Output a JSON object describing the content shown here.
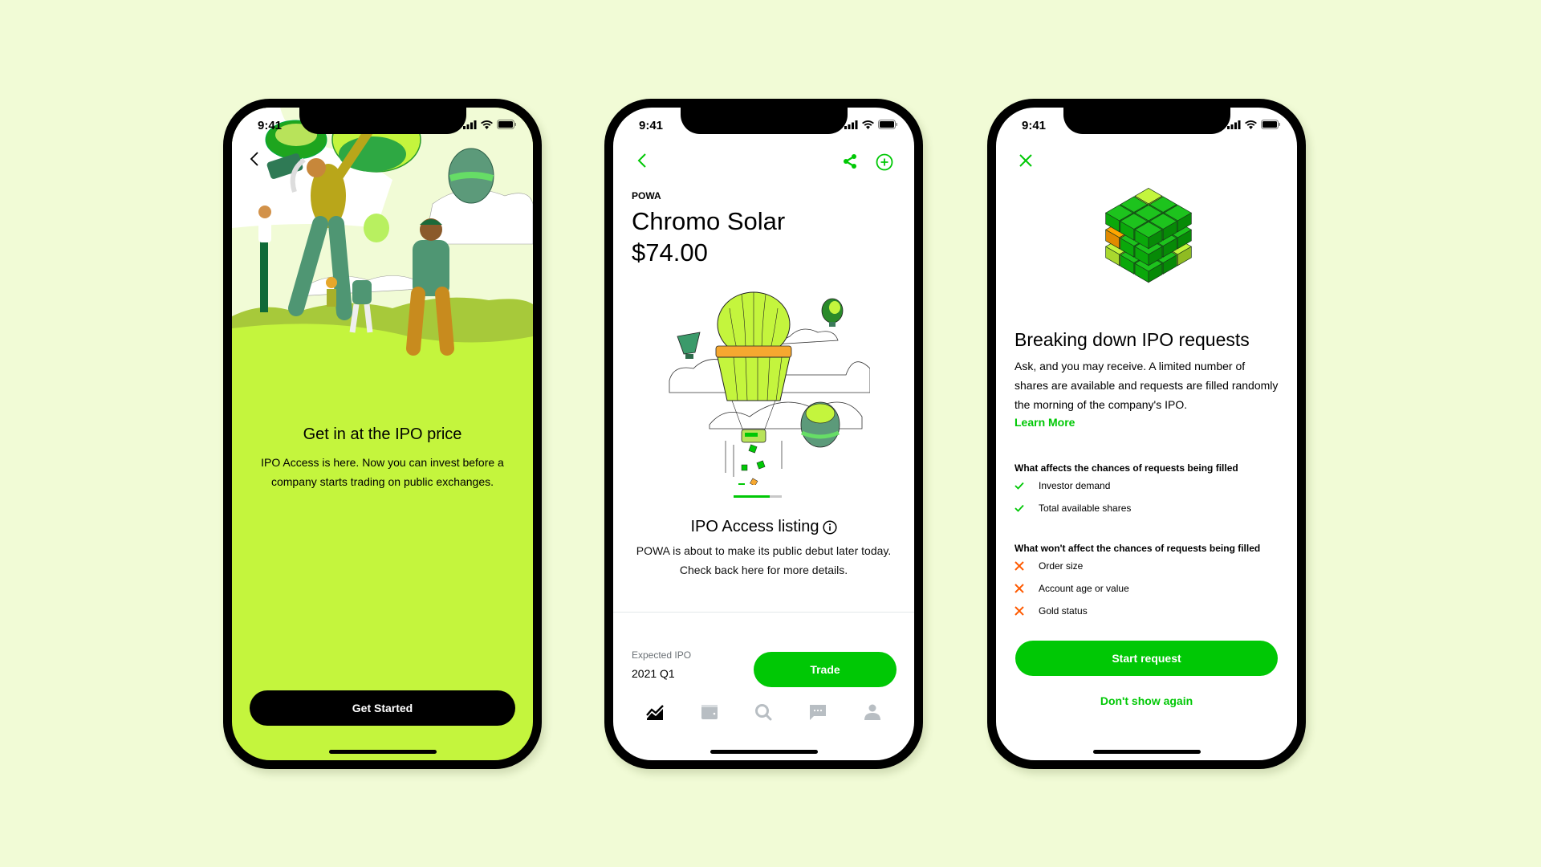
{
  "colors": {
    "background": "#f1fbd6",
    "brand_green": "#00c805",
    "lime": "#c4f53d",
    "negative_orange": "#ff5a00",
    "nav_inactive": "#b8bec3"
  },
  "status_bar": {
    "time": "9:41",
    "icons": [
      "signal-icon",
      "wifi-icon",
      "battery-icon"
    ]
  },
  "screen1": {
    "back_icon": "chevron-left-icon",
    "illustration": "people-reaching-for-hot-air-balloons",
    "title": "Get in at the IPO price",
    "body": "IPO Access is here. Now you can invest before a company starts trading on public exchanges.",
    "cta": "Get Started"
  },
  "screen2": {
    "back_icon": "chevron-left-icon",
    "share_icon": "share-icon",
    "add_icon": "plus-circle-icon",
    "ticker": "POWA",
    "company": "Chromo Solar",
    "price": "$74.00",
    "illustration": "hot-air-balloon-dropping-cubes",
    "carousel_progress": 0.75,
    "listing_title": "IPO Access listing",
    "listing_desc": "POWA is about to make its public debut later today. Check back here for more details.",
    "expected_label": "Expected IPO",
    "expected_value": "2021 Q1",
    "trade_button": "Trade",
    "nav": [
      {
        "icon": "chart-icon",
        "active": true
      },
      {
        "icon": "wallet-icon",
        "active": false
      },
      {
        "icon": "search-icon",
        "active": false
      },
      {
        "icon": "messages-icon",
        "active": false
      },
      {
        "icon": "account-icon",
        "active": false
      }
    ]
  },
  "screen3": {
    "close_icon": "close-icon",
    "illustration": "cube-puzzle",
    "title": "Breaking down IPO requests",
    "body": "Ask, and you may receive. A limited number of shares are available and requests are filled randomly the morning of the company's IPO.",
    "learn_more": "Learn More",
    "affects_heading": "What affects the chances of requests being filled",
    "affects": [
      "Investor demand",
      "Total available shares"
    ],
    "not_affects_heading": "What won't affect the chances of requests being filled",
    "not_affects": [
      "Order size",
      "Account age or value",
      "Gold status"
    ],
    "start_button": "Start request",
    "dont_show": "Don't show again"
  }
}
